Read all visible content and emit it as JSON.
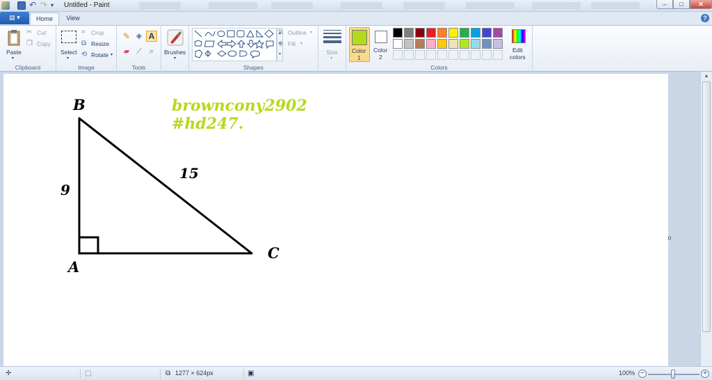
{
  "window": {
    "title": "Untitled - Paint",
    "minimize": "–",
    "maximize": "□",
    "close": "✕"
  },
  "quick_access": {
    "undo": "↶",
    "redo": "↷",
    "more": "▾"
  },
  "ribbon_tabs": {
    "file": "▤ ▾",
    "home": "Home",
    "view": "View",
    "help": "?"
  },
  "clipboard": {
    "paste": "Paste",
    "cut": "Cut",
    "copy": "Copy",
    "label": "Clipboard"
  },
  "image": {
    "select": "Select",
    "crop": "Crop",
    "resize": "Resize",
    "rotate": "Rotate",
    "label": "Image"
  },
  "tools": {
    "label": "Tools",
    "text_tool": "A"
  },
  "brushes": {
    "label": "Brushes"
  },
  "shapes": {
    "outline": "Outline",
    "fill": "Fill",
    "label": "Shapes"
  },
  "size": {
    "label": "Size"
  },
  "colors": {
    "color1_label": "Color 1",
    "color1_label_a": "Color",
    "color1_label_b": "1",
    "color2_label_a": "Color",
    "color2_label_b": "2",
    "edit_a": "Edit",
    "edit_b": "colors",
    "group_label": "Colors",
    "color1": "#b5d91c",
    "color2": "#ffffff",
    "palette_row1": [
      "#000000",
      "#7f7f7f",
      "#880015",
      "#ed1c24",
      "#ff7f27",
      "#fff200",
      "#22b14c",
      "#00a2e8",
      "#3f48cc",
      "#a349a4"
    ],
    "palette_row2": [
      "#ffffff",
      "#c3c3c3",
      "#b97a57",
      "#ffaec9",
      "#ffc90e",
      "#efe4b0",
      "#b5e61d",
      "#99d9ea",
      "#7092be",
      "#c8bfe7"
    ]
  },
  "canvas": {
    "label_b": "B",
    "label_a": "A",
    "label_c": "C",
    "side_ab": "9",
    "side_bc": "15",
    "note_line1": "browncony2902",
    "note_line2": "#hd247.",
    "note_color": "#b5d91c"
  },
  "status": {
    "dimensions": "1277 × 624px",
    "zoom": "100%",
    "zoom_out": "−",
    "zoom_in": "+"
  }
}
